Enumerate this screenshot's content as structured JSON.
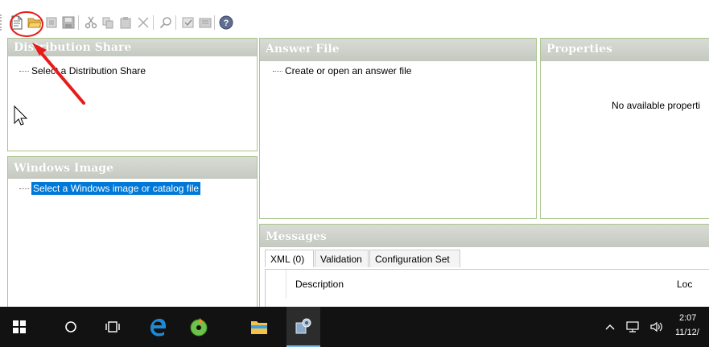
{
  "toolbar": {
    "icons": [
      "new-file-icon",
      "open-folder-icon",
      "copy-doc-icon",
      "save-icon",
      "cut-icon",
      "copy-icon",
      "paste-icon",
      "delete-icon",
      "search-icon",
      "validate-icon",
      "close-project-icon",
      "help-icon"
    ]
  },
  "distribution_share": {
    "title": "Distribution Share",
    "item": "Select a Distribution Share"
  },
  "windows_image": {
    "title": "Windows Image",
    "item": "Select a Windows image or catalog file"
  },
  "answer_file": {
    "title": "Answer File",
    "item": "Create or open an answer file"
  },
  "properties": {
    "title": "Properties",
    "empty_text": "No available properti"
  },
  "messages": {
    "title": "Messages",
    "tabs": [
      "XML (0)",
      "Validation",
      "Configuration Set"
    ],
    "columns": [
      "Description",
      "Loc"
    ]
  },
  "taskbar": {
    "time": "2:07",
    "date": "11/12/"
  },
  "colors": {
    "panel_border": "#a9c48c",
    "selection": "#0078d7",
    "annotation": "#e81a1a",
    "taskbar": "#121212"
  }
}
